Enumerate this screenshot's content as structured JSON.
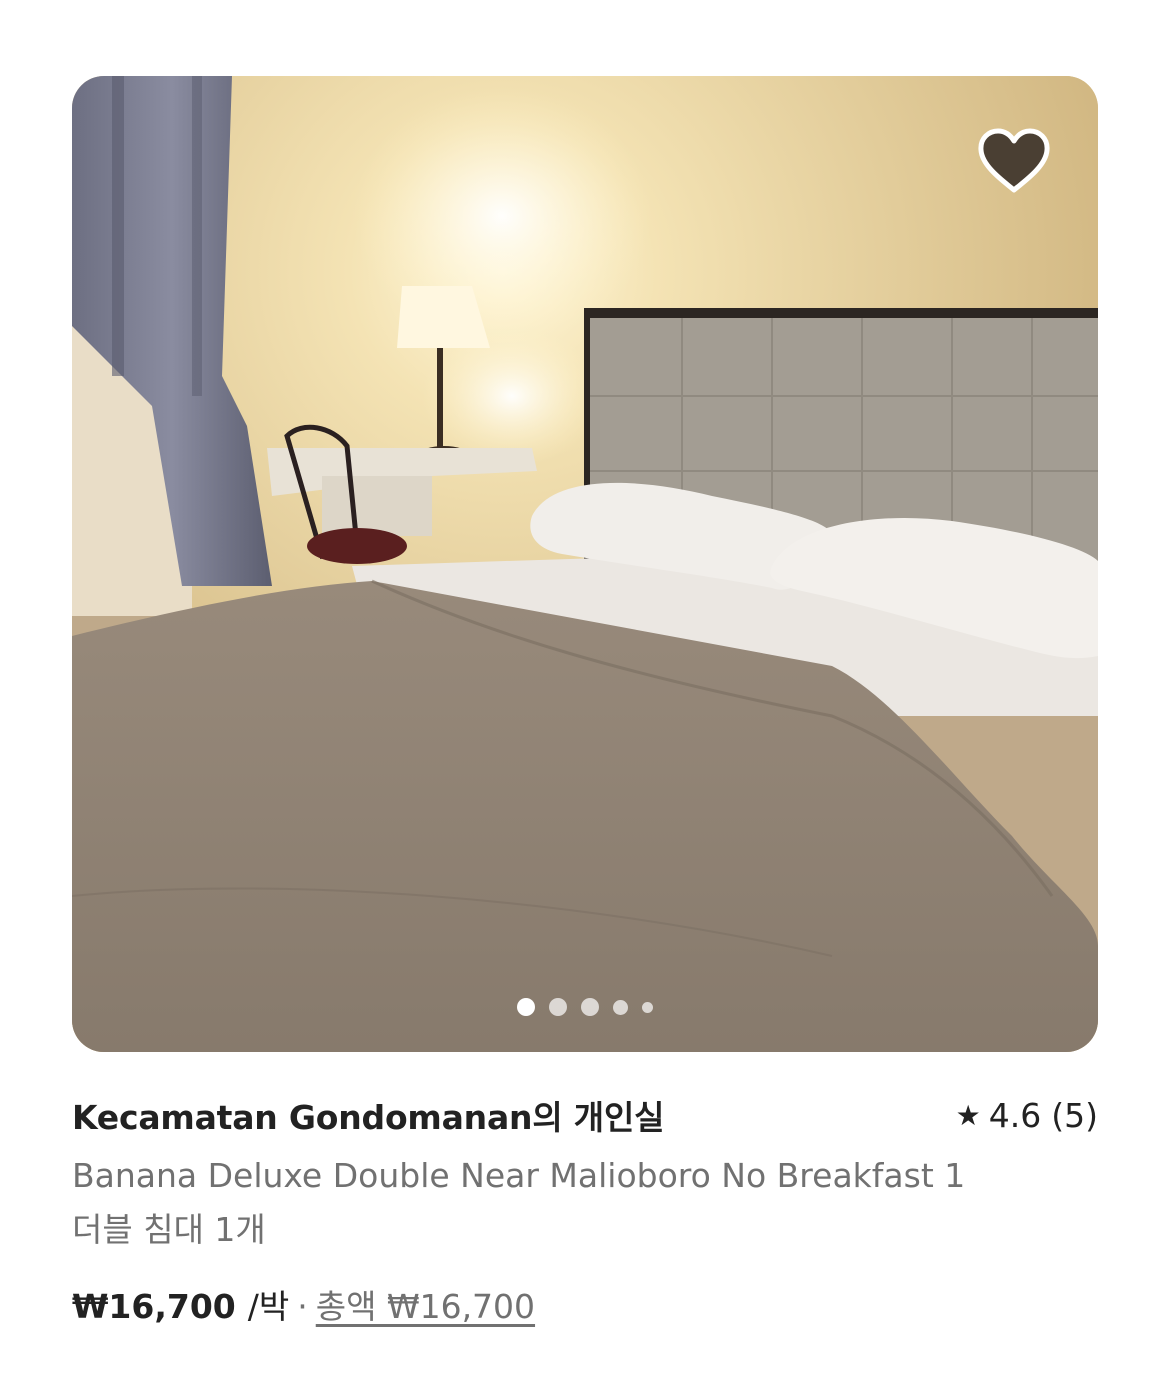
{
  "listing": {
    "title": "Kecamatan Gondomanan의 개인실",
    "rating": "4.6",
    "review_count": "(5)",
    "subtitle": "Banana Deluxe Double Near Malioboro No Breakfast 1",
    "beds": "더블 침대 1개",
    "price": "₩16,700",
    "per_night": "/박",
    "separator": "·",
    "total_label": "총액 ₩16,700"
  },
  "carousel": {
    "total": 5,
    "active": 1
  },
  "icons": {
    "favorite": "heart-icon",
    "rating": "star-icon"
  },
  "colors": {
    "primary_text": "#222222",
    "secondary_text": "#717171",
    "heart_fill": "#4a3f33"
  }
}
